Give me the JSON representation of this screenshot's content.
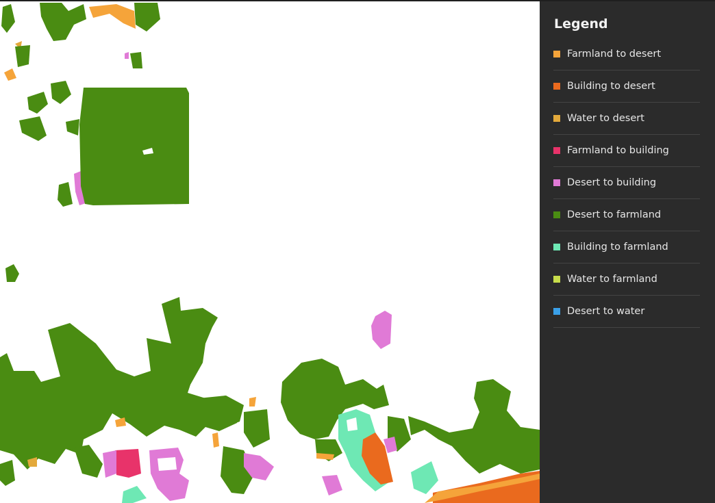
{
  "legend": {
    "title": "Legend",
    "items": [
      {
        "label": "Farmland to desert",
        "color": "#f5a43a"
      },
      {
        "label": "Building to desert",
        "color": "#ea6a1e"
      },
      {
        "label": "Water to desert",
        "color": "#e3a93b"
      },
      {
        "label": "Farmland to building",
        "color": "#e8336a"
      },
      {
        "label": "Desert to building",
        "color": "#e07ad6"
      },
      {
        "label": "Desert to farmland",
        "color": "#4a8c12"
      },
      {
        "label": "Building to farmland",
        "color": "#6ee8b4"
      },
      {
        "label": "Water to farmland",
        "color": "#c7dc4b"
      },
      {
        "label": "Desert to water",
        "color": "#3aa0e8"
      }
    ]
  }
}
